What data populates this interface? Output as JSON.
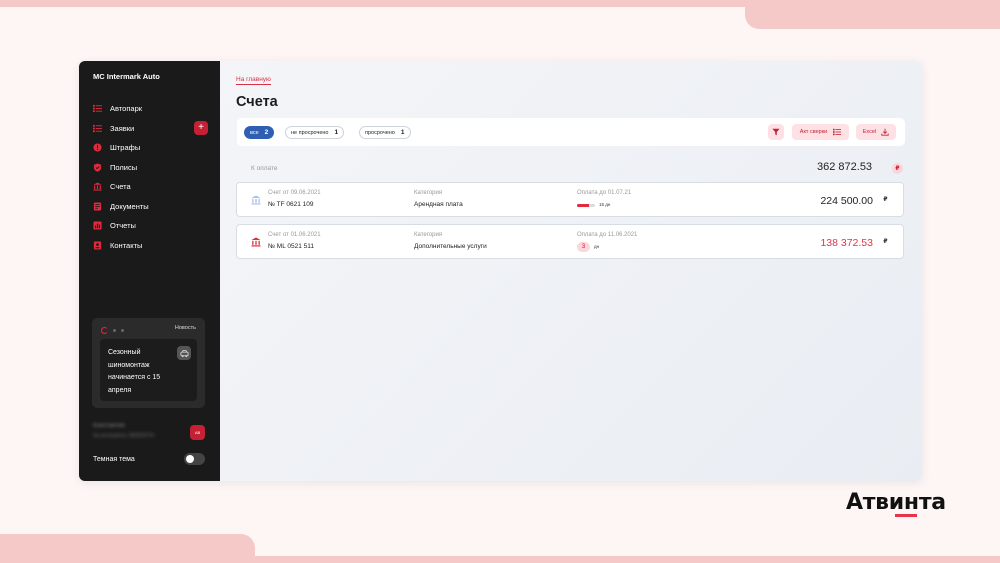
{
  "brand": {
    "name": "Атвинта"
  },
  "sidebar": {
    "company": "MC Intermark Auto",
    "items": [
      {
        "label": "Автопарк",
        "icon": "list-icon"
      },
      {
        "label": "Заявки",
        "icon": "list-icon",
        "action": "+"
      },
      {
        "label": "Штрафы",
        "icon": "alert-icon"
      },
      {
        "label": "Полисы",
        "icon": "shield-icon"
      },
      {
        "label": "Счета",
        "icon": "bank-icon"
      },
      {
        "label": "Документы",
        "icon": "document-icon"
      },
      {
        "label": "Отчеты",
        "icon": "report-icon"
      },
      {
        "label": "Контакты",
        "icon": "contacts-icon"
      }
    ],
    "news": {
      "label": "Новость",
      "text": "Сезонный шиномонтаж начинается с 15 апреля"
    },
    "user": {
      "name": "Константин",
      "contract": "№ контракта: 0825327H",
      "avatar": "AB"
    },
    "theme_label": "Темная тема"
  },
  "main": {
    "back_link": "На главную",
    "title": "Счета",
    "filters": [
      {
        "label": "все",
        "count": "2",
        "active": true
      },
      {
        "label": "не просрочено",
        "count": "1",
        "active": false
      },
      {
        "label": "просрочено",
        "count": "1",
        "active": false
      }
    ],
    "act_button": "Акт сверки",
    "excel_button": "Excel",
    "total": {
      "label": "К оплате",
      "value": "362 872.53",
      "currency": "₽"
    },
    "invoices": [
      {
        "date": "Счет от 09.06.2021",
        "number": "№ TF 0621 109",
        "category_label": "Категория",
        "category": "Арендная плата",
        "due": "Оплата до 01.07.21",
        "progress": 0.65,
        "progress_label": "15 дн",
        "amount": "224 500.00",
        "currency": "₽",
        "overdue": false
      },
      {
        "date": "Счет от 01.06.2021",
        "number": "№ ML 0521 511",
        "category_label": "Категория",
        "category": "Дополнительные услуги",
        "due": "Оплата до 11.06.2021",
        "days": "3",
        "days_unit": "дн",
        "amount": "138 372.53",
        "currency": "₽",
        "overdue": true
      }
    ]
  },
  "colors": {
    "accent": "#c62034",
    "active_chip": "#2f5fb3",
    "overdue_amount": "#e03545",
    "sidebar_bg": "#1a1a1a"
  }
}
